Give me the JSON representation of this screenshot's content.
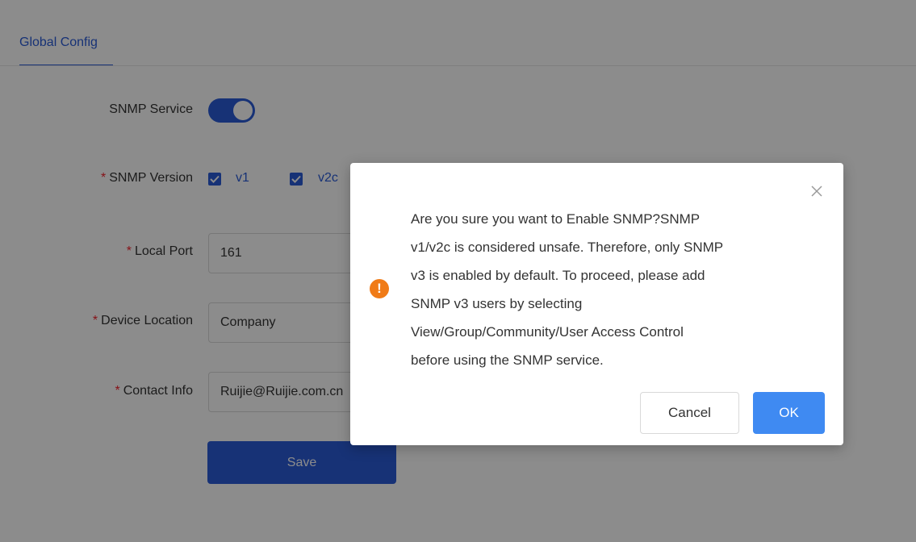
{
  "tabs": {
    "active": "Global Config"
  },
  "form": {
    "snmp_service": {
      "label": "SNMP Service",
      "enabled": true
    },
    "snmp_version": {
      "label": "SNMP Version",
      "required": "*",
      "options": [
        {
          "label": "v1",
          "checked": true
        },
        {
          "label": "v2c",
          "checked": true
        }
      ]
    },
    "local_port": {
      "label": "Local Port",
      "required": "*",
      "value": "161"
    },
    "device_location": {
      "label": "Device Location",
      "required": "*",
      "value": "Company"
    },
    "contact_info": {
      "label": "Contact Info",
      "required": "*",
      "value": "Ruijie@Ruijie.com.cn"
    },
    "save_label": "Save"
  },
  "dialog": {
    "lines": [
      "Are you sure you want to Enable SNMP?SNMP",
      "v1/v2c is considered unsafe. Therefore, only SNMP",
      "v3 is enabled by default. To proceed, please add",
      "SNMP v3 users by selecting",
      "View/Group/Community/User Access Control",
      "before using the SNMP service."
    ],
    "icons": {
      "warning": "warning-icon",
      "close": "close-icon"
    },
    "cancel_label": "Cancel",
    "ok_label": "OK"
  },
  "colors": {
    "primary": "#2a5bd7",
    "ok_button": "#3f8af2",
    "warning": "#f07b17"
  }
}
